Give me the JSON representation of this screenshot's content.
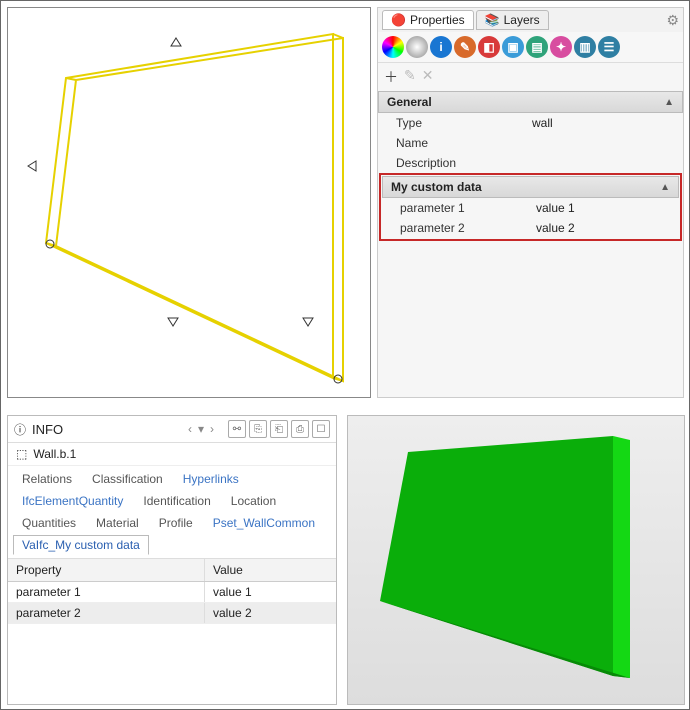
{
  "props_panel": {
    "tabs": [
      {
        "label": "Properties"
      },
      {
        "label": "Layers"
      }
    ],
    "sections": {
      "general": {
        "title": "General",
        "rows": [
          {
            "k": "Type",
            "v": "wall"
          },
          {
            "k": "Name",
            "v": ""
          },
          {
            "k": "Description",
            "v": ""
          }
        ]
      },
      "custom": {
        "title": "My custom data",
        "rows": [
          {
            "k": "parameter 1",
            "v": "value 1"
          },
          {
            "k": "parameter 2",
            "v": "value 2"
          }
        ]
      }
    }
  },
  "info_panel": {
    "title": "INFO",
    "object": "Wall.b.1",
    "tabs": [
      "Relations",
      "Classification",
      "Hyperlinks",
      "IfcElementQuantity",
      "Identification",
      "Location",
      "Quantities",
      "Material",
      "Profile",
      "Pset_WallCommon",
      "VaIfc_My custom data"
    ],
    "active_tab": "VaIfc_My custom data",
    "headers": {
      "prop": "Property",
      "val": "Value"
    },
    "rows": [
      {
        "p": "parameter 1",
        "v": "value 1"
      },
      {
        "p": "parameter 2",
        "v": "value 2"
      }
    ]
  }
}
